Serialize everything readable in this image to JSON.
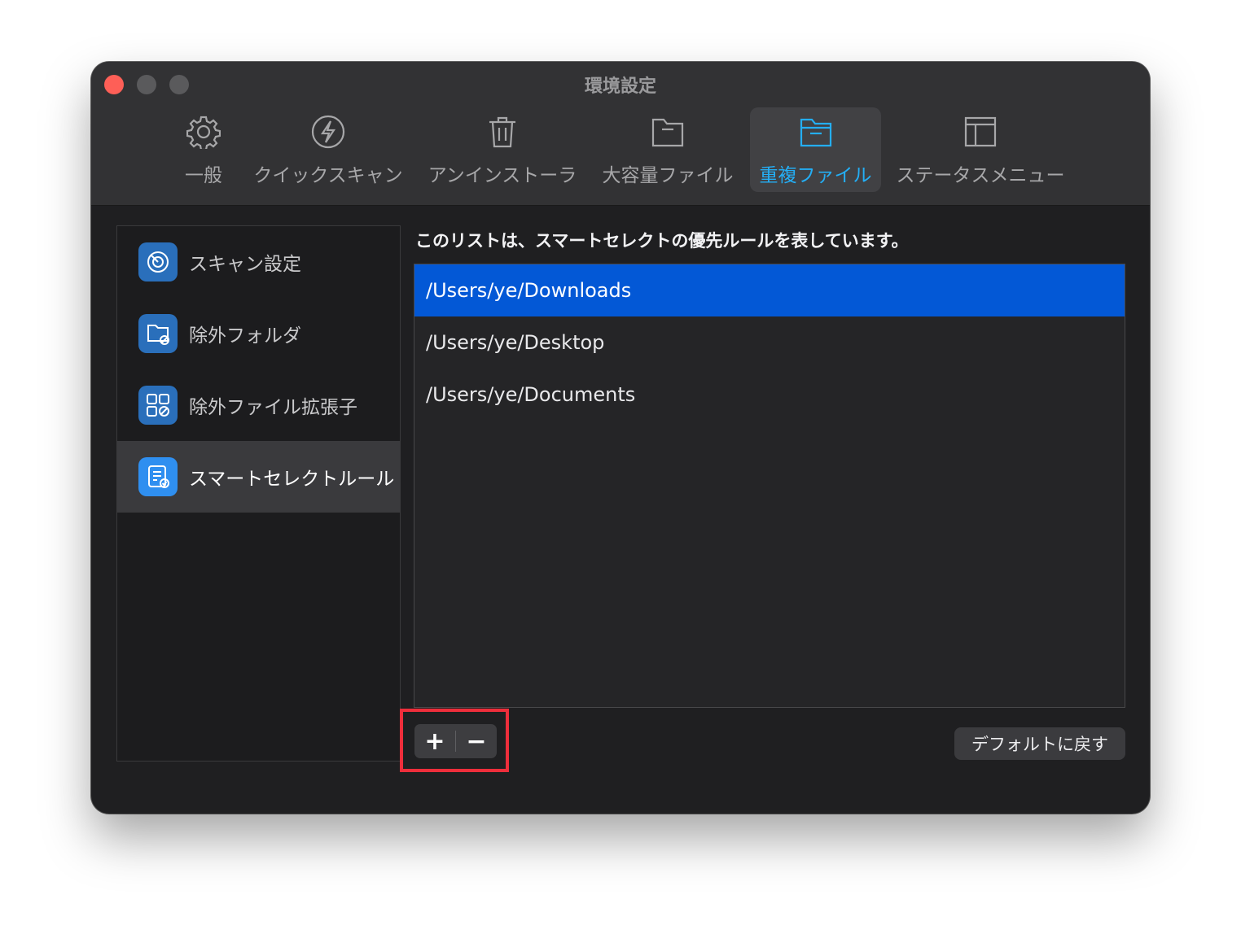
{
  "window": {
    "title": "環境設定"
  },
  "toolbar": {
    "tabs": [
      {
        "label": "一般",
        "icon": "gear-icon"
      },
      {
        "label": "クイックスキャン",
        "icon": "lightning-icon"
      },
      {
        "label": "アンインストーラ",
        "icon": "trash-icon"
      },
      {
        "label": "大容量ファイル",
        "icon": "folder-icon"
      },
      {
        "label": "重複ファイル",
        "icon": "duplicate-folder-icon",
        "active": true
      },
      {
        "label": "ステータスメニュー",
        "icon": "layout-icon"
      }
    ]
  },
  "sidebar": {
    "items": [
      {
        "label": "スキャン設定",
        "icon": "radar-icon"
      },
      {
        "label": "除外フォルダ",
        "icon": "folder-exclude-icon"
      },
      {
        "label": "除外ファイル拡張子",
        "icon": "grid-exclude-icon"
      },
      {
        "label": "スマートセレクトルール",
        "icon": "rule-list-icon",
        "active": true
      }
    ]
  },
  "main": {
    "description": "このリストは、スマートセレクトの優先ルールを表しています。",
    "paths": [
      "/Users/ye/Downloads",
      "/Users/ye/Desktop",
      "/Users/ye/Documents"
    ],
    "add_label": "+",
    "remove_label": "−",
    "reset_label": "デフォルトに戻す"
  },
  "colors": {
    "accent": "#24aef5",
    "selection": "#0358d6",
    "highlight": "#ee2e3b"
  }
}
